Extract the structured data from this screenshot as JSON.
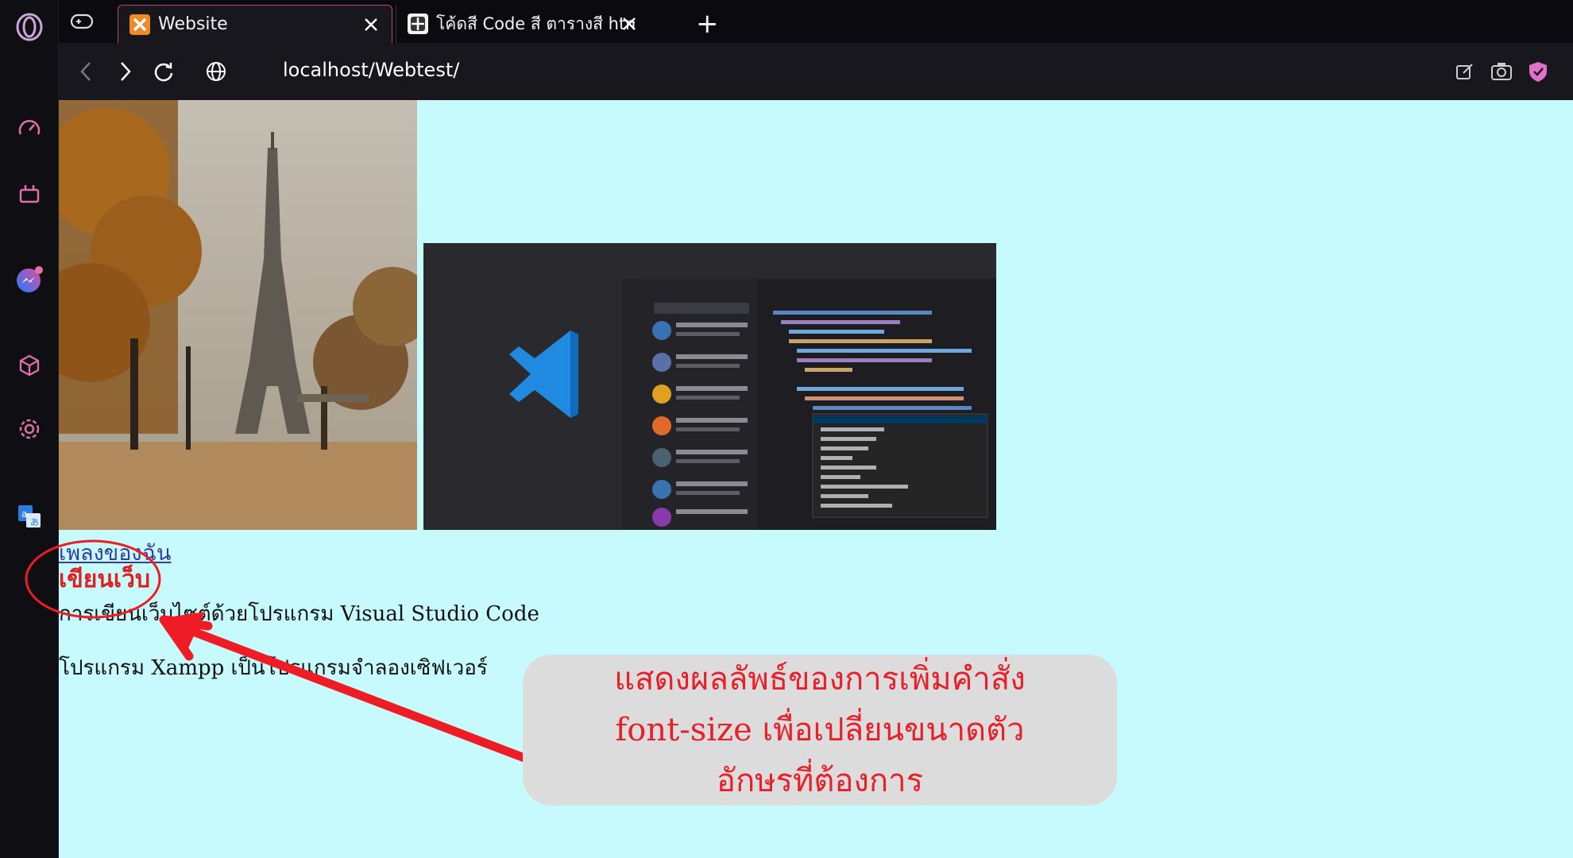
{
  "browser": {
    "tabs": [
      {
        "label": ""
      },
      {
        "label": "Website",
        "active": true
      },
      {
        "label": "โค้ดสี Code สี ตารางสี html อั"
      }
    ],
    "new_tab_label": "+",
    "url": "localhost/Webtest/",
    "accent_color": "#b24a7a"
  },
  "sidebar": {
    "icons": [
      "opera-logo-icon",
      "speed-dial-icon",
      "workspace-icon",
      "messenger-icon",
      "cube-icon",
      "settings-icon",
      "translate-icon"
    ]
  },
  "page": {
    "background": "#c6fafc",
    "link_text": "เพลงของฉัน",
    "heading": "เขียนเว็บ",
    "paragraph1": "การเขียนเว็บไซต์ด้วยโปรแกรม Visual Studio Code",
    "paragraph2": "โปรแกรม Xampp เป็นโปรแกรมจำลองเซิฟเวอร์",
    "images": [
      "eiffel-tower-photo",
      "vscode-screenshot"
    ]
  },
  "annotation": {
    "line1": "แสดงผลลัพธ์ของการเพิ่มคำสั่ง",
    "line2": "font-size เพื่อเปลี่ยนขนาดตัว",
    "line3": "อักษรที่ต้องการ",
    "color": "#e8202a"
  }
}
